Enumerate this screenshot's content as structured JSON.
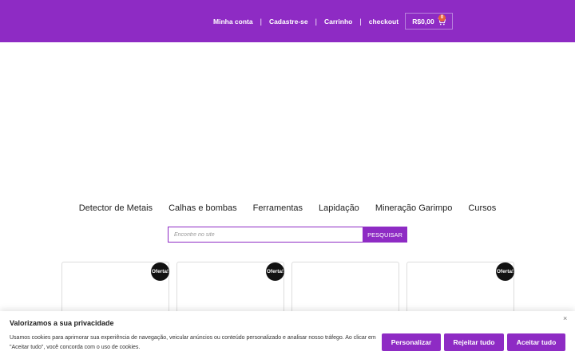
{
  "colors": {
    "brand": "#8e2bc4",
    "badge": "#111111",
    "cart_count_bg": "#e6623a"
  },
  "header": {
    "links": [
      "Minha conta",
      "Cadastre-se",
      "Carrinho",
      "checkout"
    ],
    "separator": "|",
    "cart_total": "R$0,00",
    "cart_count": "0",
    "cart_icon": "shopping-cart-icon"
  },
  "categories": [
    "Detector de Metais",
    "Calhas e bombas",
    "Ferramentas",
    "Lapidação",
    "Mineração Garimpo",
    "Cursos"
  ],
  "search": {
    "placeholder": "Encontre no site",
    "value": "",
    "button_label": "PESQUISAR"
  },
  "products": [
    {
      "badge": "Oferta!"
    },
    {
      "badge": "Oferta!"
    },
    {
      "badge": ""
    },
    {
      "badge": "Oferta!"
    }
  ],
  "cookie_banner": {
    "title": "Valorizamos a sua privacidade",
    "text": "Usamos cookies para aprimorar sua experiência de navegação, veicular anúncios ou conteúdo personalizado e analisar nosso tráfego. Ao clicar em \"Aceitar tudo\", você concorda com o uso de cookies.",
    "close_label": "×",
    "buttons": {
      "customize": "Personalizar",
      "reject": "Rejeitar tudo",
      "accept": "Aceitar tudo"
    }
  }
}
